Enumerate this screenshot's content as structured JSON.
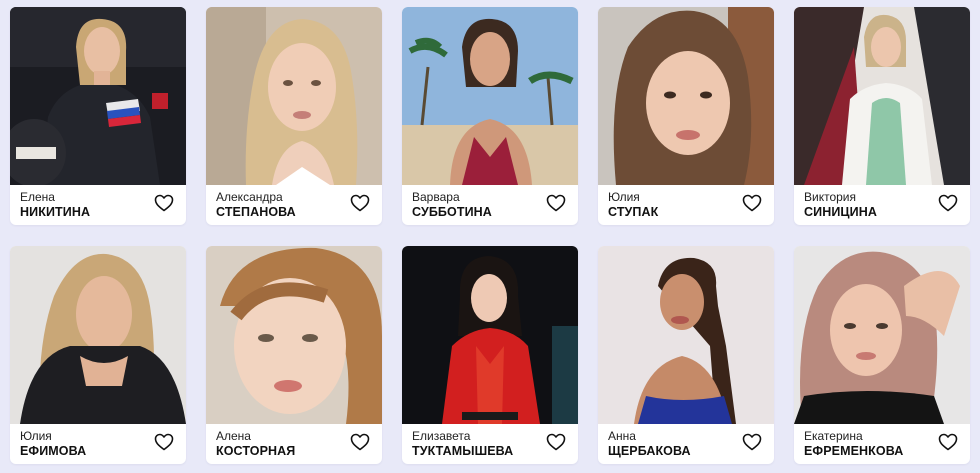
{
  "colors": {
    "page_background": "#e8e9f8",
    "card_background": "#ffffff",
    "text": "#111111",
    "heart_outline": "#111111"
  },
  "cards": [
    {
      "first_name": "Елена",
      "last_name": "НИКИТИНА",
      "icon": "heart-icon"
    },
    {
      "first_name": "Александра",
      "last_name": "СТЕПАНОВА",
      "icon": "heart-icon"
    },
    {
      "first_name": "Варвара",
      "last_name": "СУББОТИНА",
      "icon": "heart-icon"
    },
    {
      "first_name": "Юлия",
      "last_name": "СТУПАК",
      "icon": "heart-icon"
    },
    {
      "first_name": "Виктория",
      "last_name": "СИНИЦИНА",
      "icon": "heart-icon"
    },
    {
      "first_name": "Юлия",
      "last_name": "ЕФИМОВА",
      "icon": "heart-icon"
    },
    {
      "first_name": "Алена",
      "last_name": "КОСТОРНАЯ",
      "icon": "heart-icon"
    },
    {
      "first_name": "Елизавета",
      "last_name": "ТУКТАМЫШЕВА",
      "icon": "heart-icon"
    },
    {
      "first_name": "Анна",
      "last_name": "ЩЕРБАКОВА",
      "icon": "heart-icon"
    },
    {
      "first_name": "Екатерина",
      "last_name": "ЕФРЕМЕНКОВА",
      "icon": "heart-icon"
    }
  ]
}
